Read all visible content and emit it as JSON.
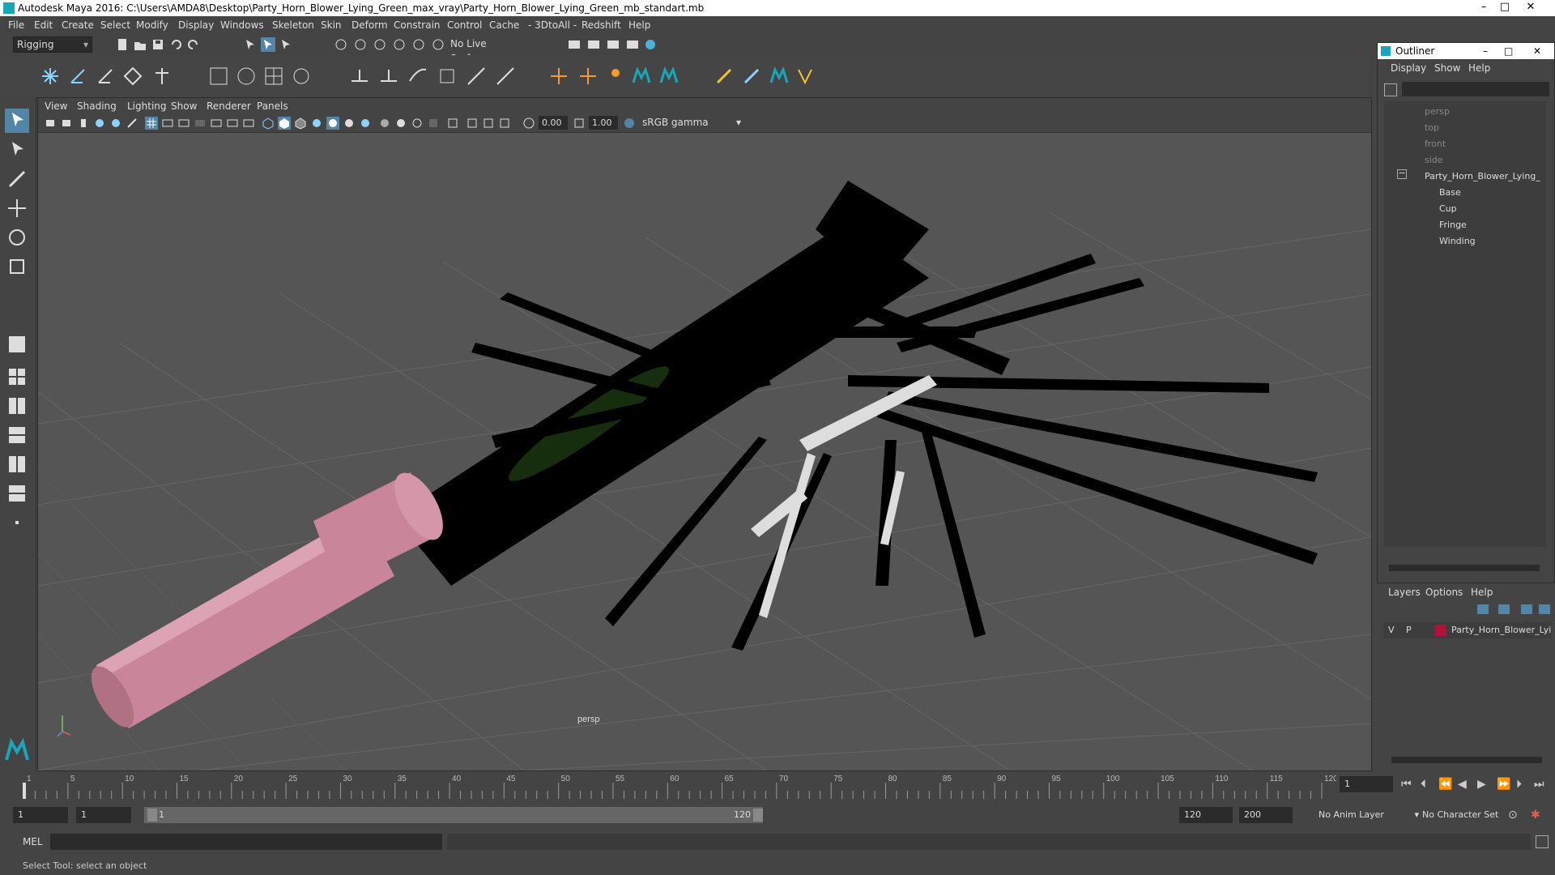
{
  "window": {
    "title": "Autodesk Maya 2016: C:\\Users\\AMDA8\\Desktop\\Party_Horn_Blower_Lying_Green_max_vray\\Party_Horn_Blower_Lying_Green_mb_standart.mb",
    "controls": [
      "minimize-icon",
      "maximize-icon",
      "close-icon"
    ]
  },
  "menubar": {
    "items": [
      "File",
      "Edit",
      "Create",
      "Select",
      "Modify",
      "Display",
      "Windows",
      "Skeleton",
      "Skin",
      "Deform",
      "Constrain",
      "Control",
      "Cache",
      "- 3DtoAll -",
      "Redshift",
      "Help"
    ]
  },
  "statusline": {
    "menu_set": "Rigging",
    "live_surface": "No Live Surface"
  },
  "viewport": {
    "menu": [
      "View",
      "Shading",
      "Lighting",
      "Show",
      "Renderer",
      "Panels"
    ],
    "exposure": "0.00",
    "gamma": "1.00",
    "color_space": "sRGB gamma",
    "camera_label": "persp"
  },
  "outliner": {
    "title": "Outliner",
    "menu": [
      "Display",
      "Show",
      "Help"
    ],
    "items": [
      {
        "label": "persp",
        "type": "camera"
      },
      {
        "label": "top",
        "type": "camera"
      },
      {
        "label": "front",
        "type": "camera"
      },
      {
        "label": "side",
        "type": "camera"
      },
      {
        "label": "Party_Horn_Blower_Lying_",
        "type": "group"
      },
      {
        "label": "Base",
        "type": "mesh"
      },
      {
        "label": "Cup",
        "type": "mesh"
      },
      {
        "label": "Fringe",
        "type": "mesh"
      },
      {
        "label": "Winding",
        "type": "mesh"
      }
    ]
  },
  "layers": {
    "menu": [
      "Layers",
      "Options",
      "Help"
    ],
    "row": {
      "v": "V",
      "p": "P",
      "name": "Party_Horn_Blower_Lyi",
      "color": "#b0123c"
    }
  },
  "timeslider": {
    "ticks": [
      "1",
      "5",
      "10",
      "15",
      "20",
      "25",
      "30",
      "35",
      "40",
      "45",
      "50",
      "55",
      "60",
      "65",
      "70",
      "75",
      "80",
      "85",
      "90",
      "95",
      "100",
      "105",
      "110",
      "115",
      "120"
    ],
    "current_frame": "1"
  },
  "range": {
    "start": "1",
    "playback_start": "1",
    "slider_start": "1",
    "slider_end": "120",
    "playback_end": "120",
    "end": "200",
    "anim_layer": "No Anim Layer",
    "character_set": "No Character Set"
  },
  "cmdline": {
    "lang": "MEL"
  },
  "helpline": {
    "text": "Select Tool: select an object"
  }
}
